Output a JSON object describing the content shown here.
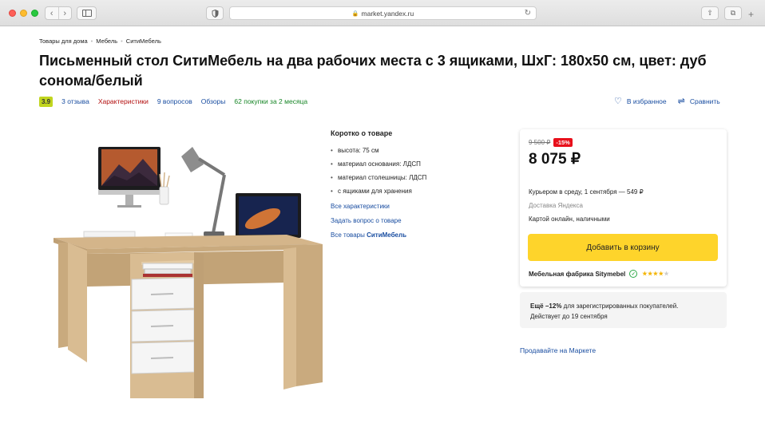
{
  "browser": {
    "url": "market.yandex.ru"
  },
  "breadcrumb": [
    "Товары для дома",
    "Мебель",
    "СитиМебель"
  ],
  "product": {
    "title": "Письменный стол СитиМебель на два рабочих места с 3 ящиками, ШхГ: 180х50 см, цвет: дуб сонома/белый",
    "rating": "3.9",
    "reviews": "3 отзыва",
    "specs_link": "Характеристики",
    "questions": "9 вопросов",
    "overviews": "Обзоры",
    "purchases": "62 покупки за 2 месяца",
    "favorite": "В избранное",
    "compare": "Сравнить"
  },
  "short_info": {
    "title": "Коротко о товаре",
    "items": [
      "высота: 75 см",
      "материал основания: ЛДСП",
      "материал столешницы: ЛДСП",
      "с ящиками для хранения"
    ],
    "all_specs": "Все характеристики",
    "ask_question": "Задать вопрос о товаре",
    "all_goods_prefix": "Все товары",
    "all_goods_brand": "СитиМебель"
  },
  "offer": {
    "old_price": "9 500 ₽",
    "discount": "-15%",
    "price": "8 075 ₽",
    "delivery": "Курьером в среду, 1 сентября — 549 ₽",
    "delivery_by": "Доставка Яндекса",
    "payment": "Картой онлайн, наличными",
    "cart_button": "Добавить в корзину",
    "seller": "Мебельная фабрика Sitymebel",
    "seller_rating": 4
  },
  "promo": {
    "bold": "Ещё −12%",
    "text": " для зарегистрированных покупателей.",
    "line2": "Действует до 19 сентября"
  },
  "sell_link": "Продавайте на Маркете",
  "colors": {
    "accent_yellow": "#fed42b",
    "discount_red": "#e8101b",
    "link_blue": "#1a4ea1",
    "rating_green": "#c1d51f"
  }
}
